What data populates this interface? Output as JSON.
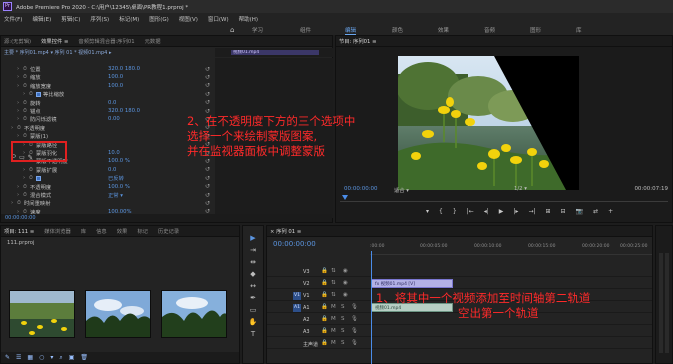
{
  "titlebar": {
    "logo": "Pr",
    "title": "Adobe Premiere Pro 2020 - C:\\用户\\12345\\桌面\\PR教程1.prproj *"
  },
  "menubar": {
    "items": [
      "文件(F)",
      "编辑(E)",
      "剪辑(C)",
      "序列(S)",
      "标记(M)",
      "图形(G)",
      "视图(V)",
      "窗口(W)",
      "帮助(H)"
    ]
  },
  "workspace": {
    "tabs": [
      "学习",
      "组件",
      "编辑",
      "颜色",
      "效果",
      "音频",
      "图形",
      "库"
    ],
    "active_index": 2
  },
  "effect_controls": {
    "tabs": [
      "源:(无剪辑)",
      "效果控件 ≡",
      "音频剪辑混合器:序列01",
      "元数据"
    ],
    "clip_label": "主要 * 序列01.mp4 ▾   序列 01 * 视频01.mp4 ▸",
    "clip_bar_label": "视频01.mp4",
    "properties": [
      {
        "indent": 2,
        "name": "位置",
        "value": "320.0  180.0"
      },
      {
        "indent": 2,
        "name": "缩放",
        "value": "100.0"
      },
      {
        "indent": 2,
        "name": "缩放宽度",
        "value": "100.0"
      },
      {
        "indent": 3,
        "name": "等比缩放",
        "value": "",
        "checked": true
      },
      {
        "indent": 2,
        "name": "旋转",
        "value": "0.0"
      },
      {
        "indent": 2,
        "name": "锚点",
        "value": "320.0  180.0"
      },
      {
        "indent": 2,
        "name": "防闪烁滤镜",
        "value": "0.00"
      },
      {
        "indent": 1,
        "name": "不透明度",
        "value": ""
      },
      {
        "indent": 2,
        "name": "蒙版(1)",
        "value": ""
      },
      {
        "indent": 3,
        "name": "蒙版路径",
        "value": ""
      },
      {
        "indent": 3,
        "name": "蒙版羽化",
        "value": "10.0"
      },
      {
        "indent": 3,
        "name": "蒙版不透明度",
        "value": "100.0 %"
      },
      {
        "indent": 3,
        "name": "蒙版扩展",
        "value": "0.0"
      },
      {
        "indent": 3,
        "name": "",
        "value": "已反转",
        "checked": true
      },
      {
        "indent": 2,
        "name": "不透明度",
        "value": "100.0 %"
      },
      {
        "indent": 2,
        "name": "混合模式",
        "value": "正常 ▾"
      },
      {
        "indent": 1,
        "name": "时间重映射",
        "value": ""
      },
      {
        "indent": 2,
        "name": "速度",
        "value": "100.00%"
      }
    ],
    "mask_tools": [
      "⬭",
      "▭",
      "✎"
    ],
    "footer_timecode": "00:00:00:00"
  },
  "program_monitor": {
    "tabs": [
      "节目: 序列01 ≡"
    ],
    "timecode": "00:00:00:00",
    "fit": "适合 ▾",
    "ratio": "1/2 ▾",
    "duration": "00:00:07:19",
    "transport": [
      "▾",
      "{",
      "}",
      "|←",
      "◂|",
      "▶",
      "|▸",
      "→|",
      "⊞",
      "⊟",
      "📷",
      "⇄",
      "+"
    ]
  },
  "project": {
    "tabs": [
      "项目: 111 ≡",
      "媒体浏览器",
      "库",
      "信息",
      "效果",
      "标记",
      "历史记录"
    ],
    "name": "111.prproj",
    "footer_icons": [
      "✎",
      "☰",
      "▦",
      "○",
      "▾",
      "⌕",
      "▣",
      "🗑"
    ]
  },
  "tools": [
    "▶",
    "⇥",
    "⇹",
    "◆",
    "↔",
    "✒",
    "▭",
    "✋",
    "T"
  ],
  "timeline": {
    "tabs": [
      "× 序列 01 ≡"
    ],
    "timecode": "00:00:00:00",
    "ticks": [
      ":00:00",
      "00:00:05:00",
      "00:00:10:00",
      "00:00:15:00",
      "00:00:20:00",
      "00:00:25:00"
    ],
    "tracks": [
      {
        "label": "V3",
        "target": "",
        "clip": ""
      },
      {
        "label": "V2",
        "target": "",
        "clip": "fx 视频01.mp4 [V]"
      },
      {
        "label": "V1",
        "target": "V1",
        "clip": ""
      },
      {
        "label": "A1",
        "target": "A1",
        "clip": "视频01.mp4"
      },
      {
        "label": "A2",
        "target": "",
        "clip": ""
      },
      {
        "label": "A3",
        "target": "",
        "clip": ""
      },
      {
        "label": "主声道",
        "target": "",
        "clip": ""
      }
    ],
    "master_value": "0.0"
  },
  "annotations": {
    "step2": [
      "2、在不透明度下方的三个选项中",
      "选择一个来绘制蒙版图案,",
      "并在监视器面板中调整蒙版"
    ],
    "step1": [
      "1、将其中一个视频添加至时间轴第二轨道",
      "空出第一个轨道"
    ]
  },
  "colors": {
    "accent": "#5b95e0",
    "annotation": "#ff2a2a",
    "highlight_box": "#e02020",
    "video_clip": "#b3b1e6",
    "audio_clip": "#b7cfc4"
  }
}
